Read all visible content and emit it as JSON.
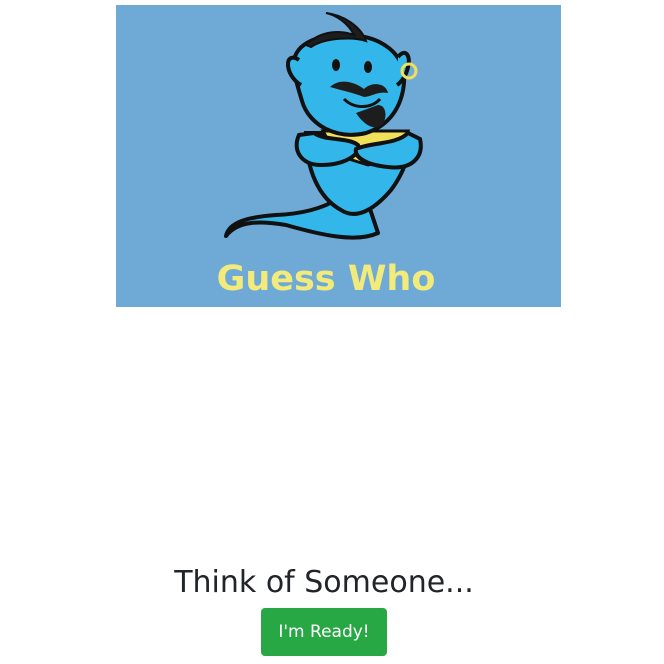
{
  "banner": {
    "title": "Guess Who",
    "image_name": "genie-mascot",
    "background_color": "#6fa9d6",
    "title_color": "#f3ea7c"
  },
  "prompt": {
    "text": "Think of Someone..."
  },
  "actions": {
    "ready_label": "I'm Ready!",
    "ready_color": "#28a745"
  }
}
